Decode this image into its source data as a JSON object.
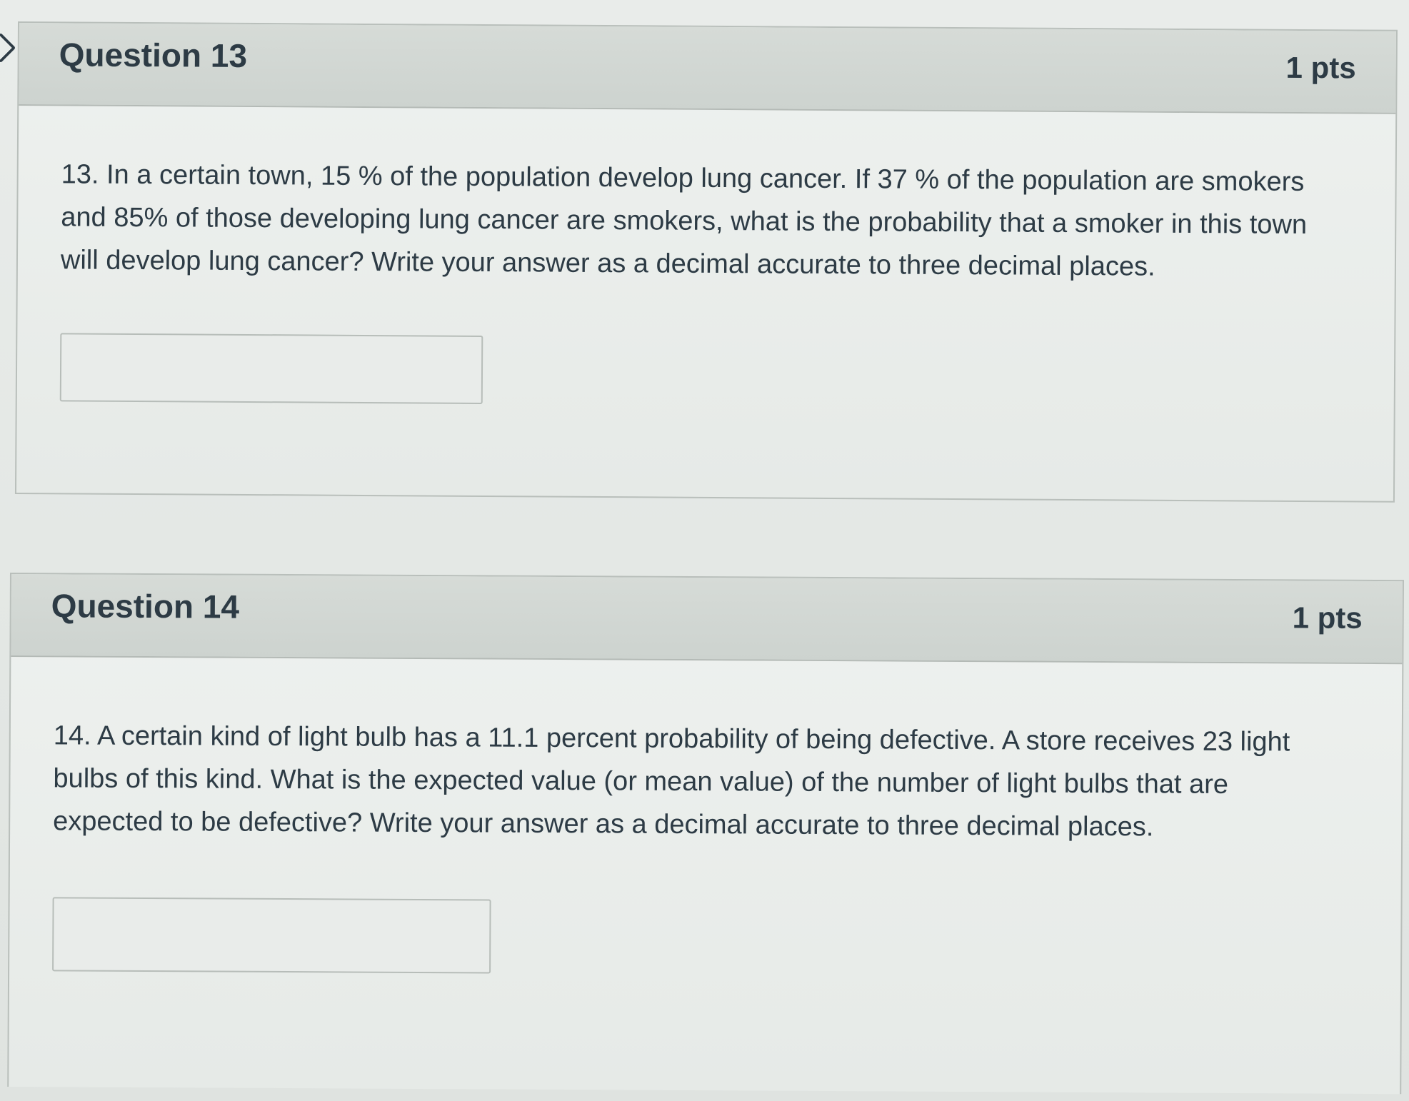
{
  "questions": [
    {
      "title": "Question 13",
      "points": "1 pts",
      "text": "13.  In a certain town, 15 % of the population develop lung cancer.  If 37 % of the population are smokers and 85% of those developing lung cancer are smokers, what is the probability that a smoker in this town will develop lung cancer?  Write your answer as a decimal accurate to three decimal places.",
      "answer_value": ""
    },
    {
      "title": "Question 14",
      "points": "1 pts",
      "text": "14.  A certain kind of light bulb has a 11.1 percent probability of being defective.  A store receives 23 light bulbs of this kind.  What is the expected value (or mean value) of the number of light bulbs that are expected to be defective?  Write your answer as a decimal accurate to three decimal places.",
      "answer_value": ""
    }
  ],
  "icons": {
    "nav": "chevron-right-icon"
  }
}
